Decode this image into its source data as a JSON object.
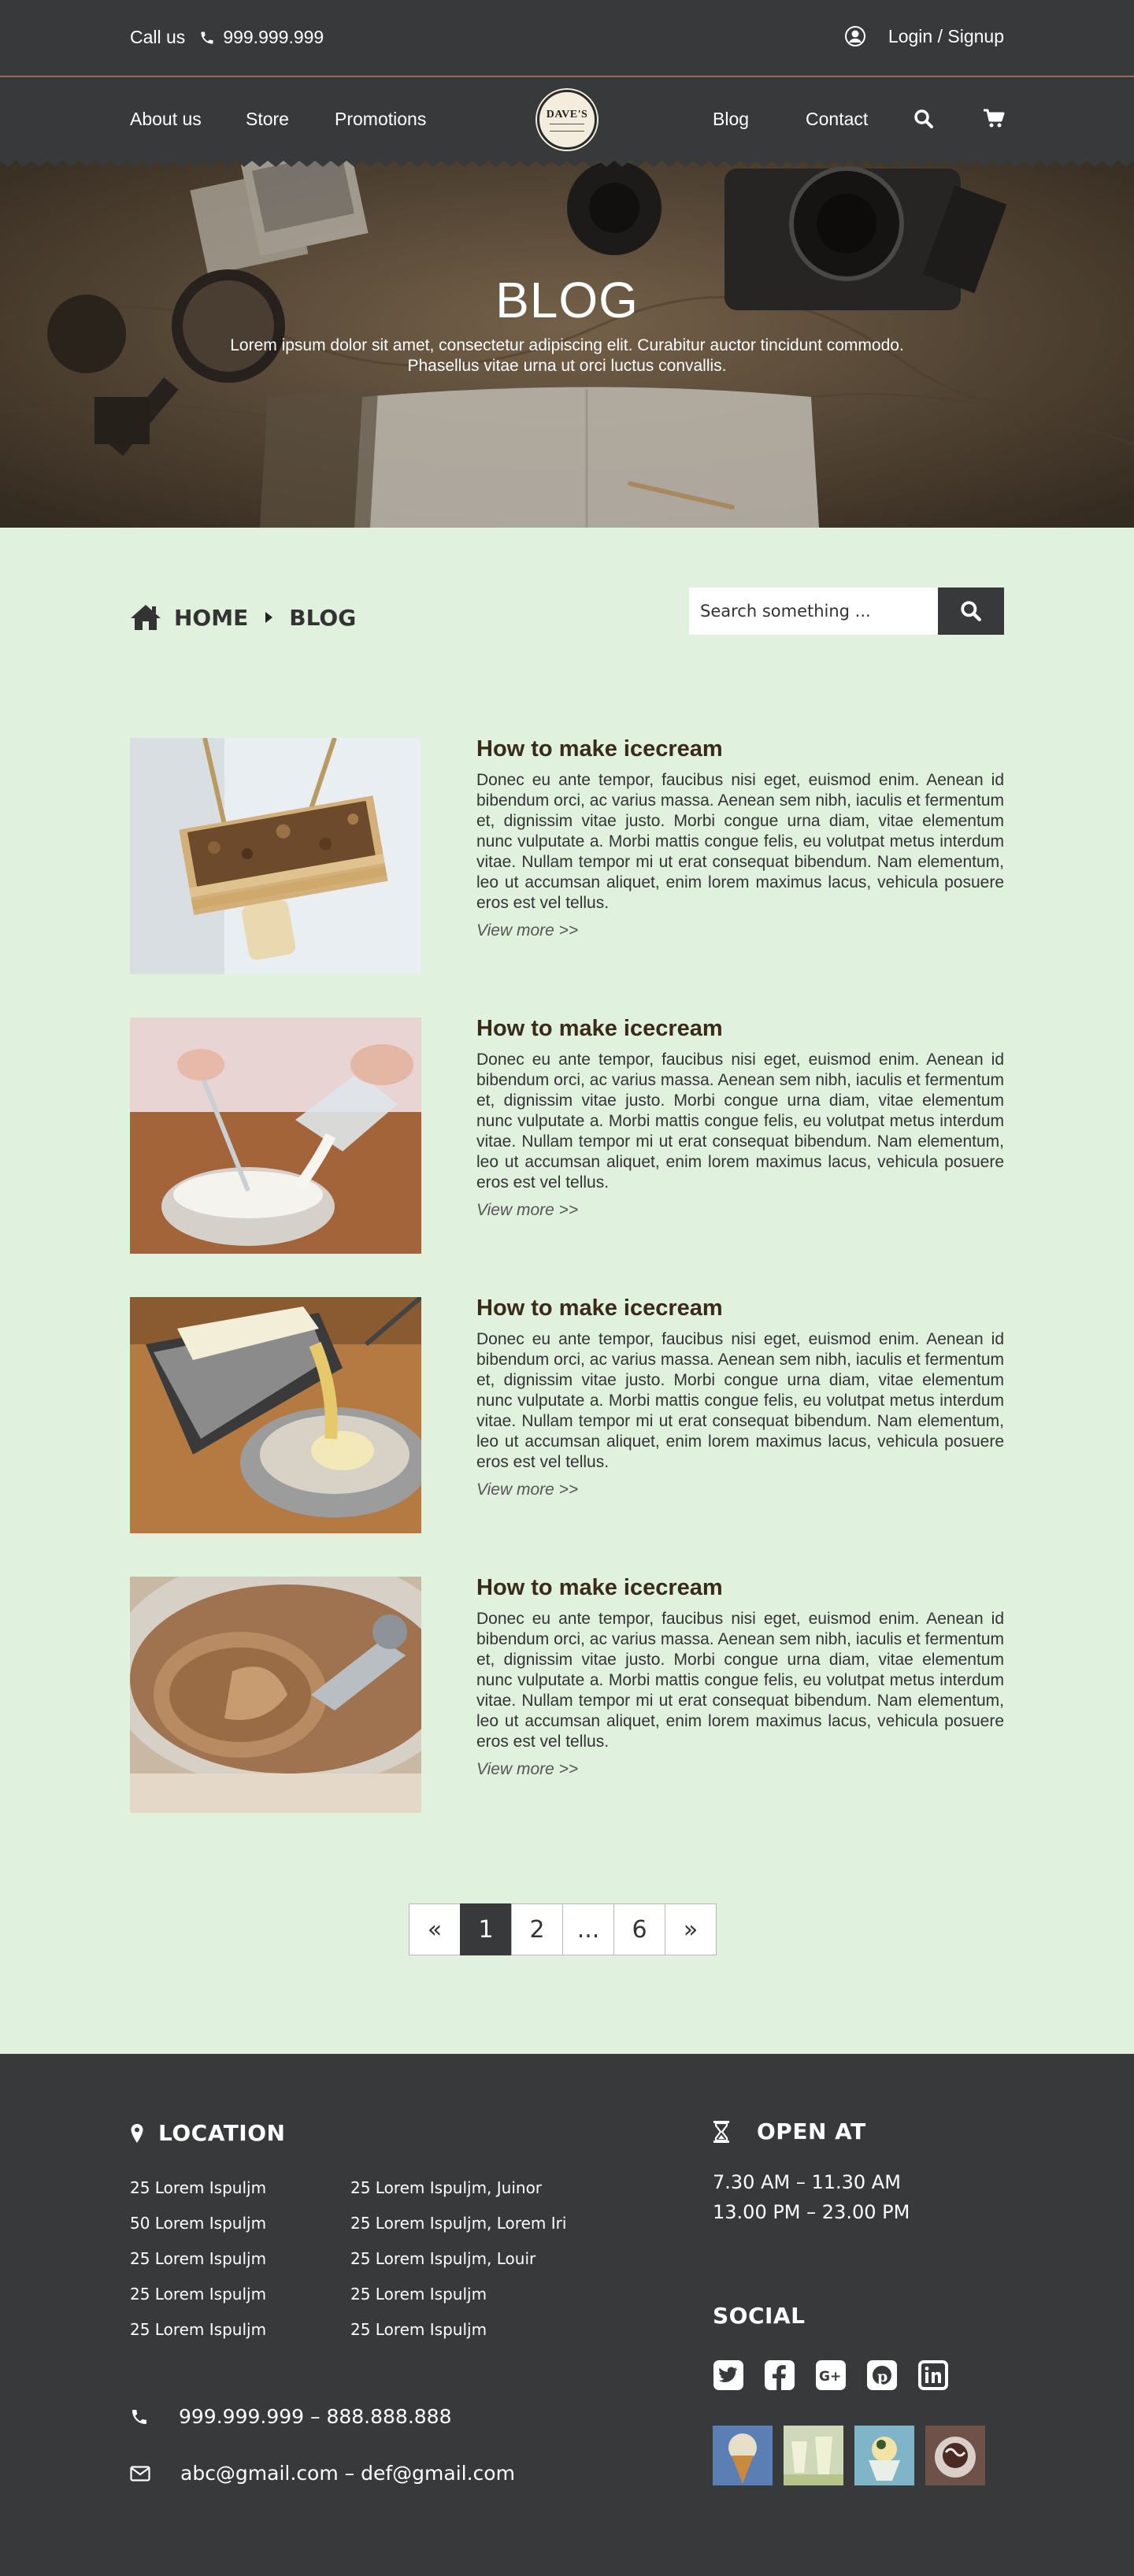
{
  "topbar": {
    "call_label": "Call us",
    "phone": "999.999.999",
    "login_label": "Login / Signup"
  },
  "nav": {
    "items": [
      "About us",
      "Store",
      "Promotions",
      "Blog",
      "Contact"
    ],
    "logo_text": "DAVE'S"
  },
  "hero": {
    "title": "BLOG",
    "subtitle": "Lorem ipsum dolor sit amet, consectetur adipiscing elit. Curabitur auctor tincidunt commodo. Phasellus vitae urna ut orci luctus convallis."
  },
  "breadcrumb": {
    "home": "HOME",
    "current": "BLOG"
  },
  "search": {
    "placeholder": "Search something ..."
  },
  "posts": [
    {
      "title": "How to make icecream",
      "body": "Donec eu ante tempor, faucibus nisi eget, euismod enim. Aenean id bibendum orci, ac varius massa. Aenean sem nibh, iaculis et fermentum et, dignissim vitae justo. Morbi congue urna diam, vitae elementum nunc vulputate a. Morbi mattis congue felis, eu volutpat metus interdum vitae. Nullam tempor mi ut erat consequat bibendum. Nam elementum, leo ut accumsan aliquet, enim lorem maximus lacus, vehicula posuere eros est vel tellus.",
      "more": "View more >>"
    },
    {
      "title": "How to make icecream",
      "body": "Donec eu ante tempor, faucibus nisi eget, euismod enim. Aenean id bibendum orci, ac varius massa. Aenean sem nibh, iaculis et fermentum et, dignissim vitae justo. Morbi congue urna diam, vitae elementum nunc vulputate a. Morbi mattis congue felis, eu volutpat metus interdum vitae. Nullam tempor mi ut erat consequat bibendum. Nam elementum, leo ut accumsan aliquet, enim lorem maximus lacus, vehicula posuere eros est vel tellus.",
      "more": "View more >>"
    },
    {
      "title": "How to make icecream",
      "body": "Donec eu ante tempor, faucibus nisi eget, euismod enim. Aenean id bibendum orci, ac varius massa. Aenean sem nibh, iaculis et fermentum et, dignissim vitae justo. Morbi congue urna diam, vitae elementum nunc vulputate a. Morbi mattis congue felis, eu volutpat metus interdum vitae. Nullam tempor mi ut erat consequat bibendum. Nam elementum, leo ut accumsan aliquet, enim lorem maximus lacus, vehicula posuere eros est vel tellus.",
      "more": "View more >>"
    },
    {
      "title": "How to make icecream",
      "body": "Donec eu ante tempor, faucibus nisi eget, euismod enim. Aenean id bibendum orci, ac varius massa. Aenean sem nibh, iaculis et fermentum et, dignissim vitae justo. Morbi congue urna diam, vitae elementum nunc vulputate a. Morbi mattis congue felis, eu volutpat metus interdum vitae. Nullam tempor mi ut erat consequat bibendum. Nam elementum, leo ut accumsan aliquet, enim lorem maximus lacus, vehicula posuere eros est vel tellus.",
      "more": "View more >>"
    }
  ],
  "pagination": {
    "prev": "«",
    "pages": [
      "1",
      "2",
      "...",
      "6"
    ],
    "next": "»",
    "current": "1"
  },
  "footer": {
    "location_title": "LOCATION",
    "locations_left": [
      "25 Lorem Ispuljm",
      "50 Lorem Ispuljm",
      "25 Lorem Ispuljm",
      "25 Lorem Ispuljm",
      "25 Lorem Ispuljm"
    ],
    "locations_right": [
      "25 Lorem Ispuljm, Juinor",
      "25 Lorem Ispuljm, Lorem Iri",
      "25 Lorem Ispuljm, Louir",
      "25 Lorem Ispuljm",
      "25 Lorem Ispuljm"
    ],
    "phones": "999.999.999 – 888.888.888",
    "emails": "abc@gmail.com – def@gmail.com",
    "open_title": "OPEN AT",
    "hours": [
      "7.30 AM  – 11.30 AM",
      "13.00 PM  – 23.00 PM"
    ],
    "social_title": "SOCIAL",
    "social_icons": [
      "twitter-icon",
      "facebook-icon",
      "google-plus-icon",
      "pinterest-icon",
      "linkedin-icon"
    ]
  },
  "colors": {
    "dark": "#38393b",
    "background": "#e0f1de",
    "divider": "#8b6f5a",
    "post_title": "#3a2a1a"
  }
}
